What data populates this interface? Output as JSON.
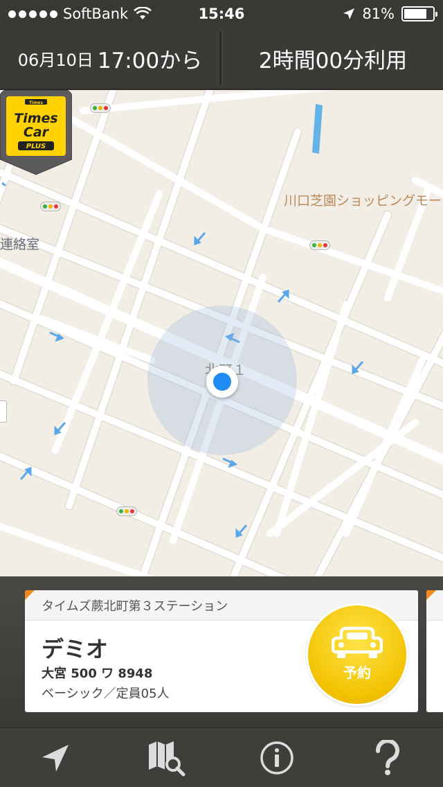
{
  "status_bar": {
    "carrier": "SoftBank",
    "time": "15:46",
    "battery": "81%",
    "battery_level": 0.81,
    "icons": [
      "signal-dots",
      "wifi-icon",
      "location-arrow-icon",
      "battery-icon"
    ]
  },
  "header": {
    "date": "06月10日",
    "start_time": "17:00から",
    "duration": "2時間00分利用"
  },
  "map": {
    "labels": {
      "shopping": "川口芝園ショッピングモー",
      "office": "連絡室",
      "district": "北町１"
    },
    "pin_brand": {
      "line1": "Times",
      "line2": "Car",
      "line3": "PLUS",
      "badge": "Times"
    },
    "colors": {
      "road": "#ffffff",
      "ground": "#f2eee6",
      "water": "#63b4e6",
      "location": "#1f8bf2"
    }
  },
  "station_card": {
    "station_name": "タイムズ蕨北町第３ステーション",
    "car_name": "デミオ",
    "plate": "大宮 500 ワ 8948",
    "spec": "ベーシック／定員05人",
    "reserve_label": "予約",
    "accent": "#f28a1e",
    "button_color": "#f2c200"
  },
  "tab_bar": {
    "items": [
      {
        "name": "location-arrow-icon"
      },
      {
        "name": "map-search-icon"
      },
      {
        "name": "info-icon"
      },
      {
        "name": "help-icon"
      }
    ]
  }
}
